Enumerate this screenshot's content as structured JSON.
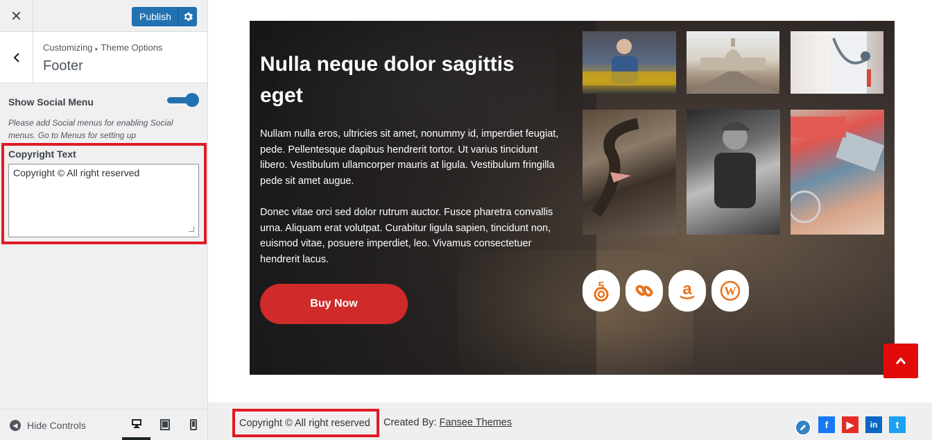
{
  "customizer": {
    "close_icon": "close-icon",
    "publish_label": "Publish",
    "breadcrumb": {
      "root": "Customizing",
      "parent": "Theme Options"
    },
    "section_title": "Footer",
    "show_social_menu": {
      "label": "Show Social Menu",
      "enabled": true
    },
    "social_note": "Please add Social menus for enabling Social menus. Go to Menus for setting up",
    "copyright_field": {
      "label": "Copyright Text",
      "value": "Copyright © All right reserved"
    },
    "footer": {
      "hide_controls_label": "Hide Controls",
      "devices": [
        "desktop",
        "tablet",
        "mobile"
      ],
      "active_device": "desktop"
    },
    "accent_color": "#2271b1"
  },
  "preview": {
    "hero": {
      "title": "Nulla neque dolor sagittis eget",
      "paragraph1": "Nullam nulla eros, ultricies sit amet, nonummy id, imperdiet feugiat, pede. Pellentesque dapibus hendrerit tortor. Ut varius tincidunt libero. Vestibulum ullamcorper mauris at ligula. Vestibulum fringilla pede sit amet augue.",
      "paragraph2": "Donec vitae orci sed dolor rutrum auctor. Fusce pharetra convallis urna. Aliquam erat volutpat. Curabitur ligula sapien, tincidunt non, euismod vitae, posuere imperdiet, leo. Vivamus consectetuer hendrerit lacus.",
      "button_label": "Buy Now",
      "button_color": "#d02b2b",
      "social_icons": [
        "500px-icon",
        "link-icon",
        "amazon-icon",
        "wordpress-icon"
      ],
      "icon_color": "#e8721c"
    },
    "footer": {
      "copyright": "Copyright © All right reserved",
      "created_by_label": "Created By:",
      "created_by_link": "Fansee Themes",
      "social": [
        {
          "icon": "facebook-icon",
          "glyph": "f"
        },
        {
          "icon": "youtube-icon",
          "glyph": "▶"
        },
        {
          "icon": "linkedin-icon",
          "glyph": "in"
        },
        {
          "icon": "twitter-icon",
          "glyph": "t"
        }
      ]
    }
  }
}
